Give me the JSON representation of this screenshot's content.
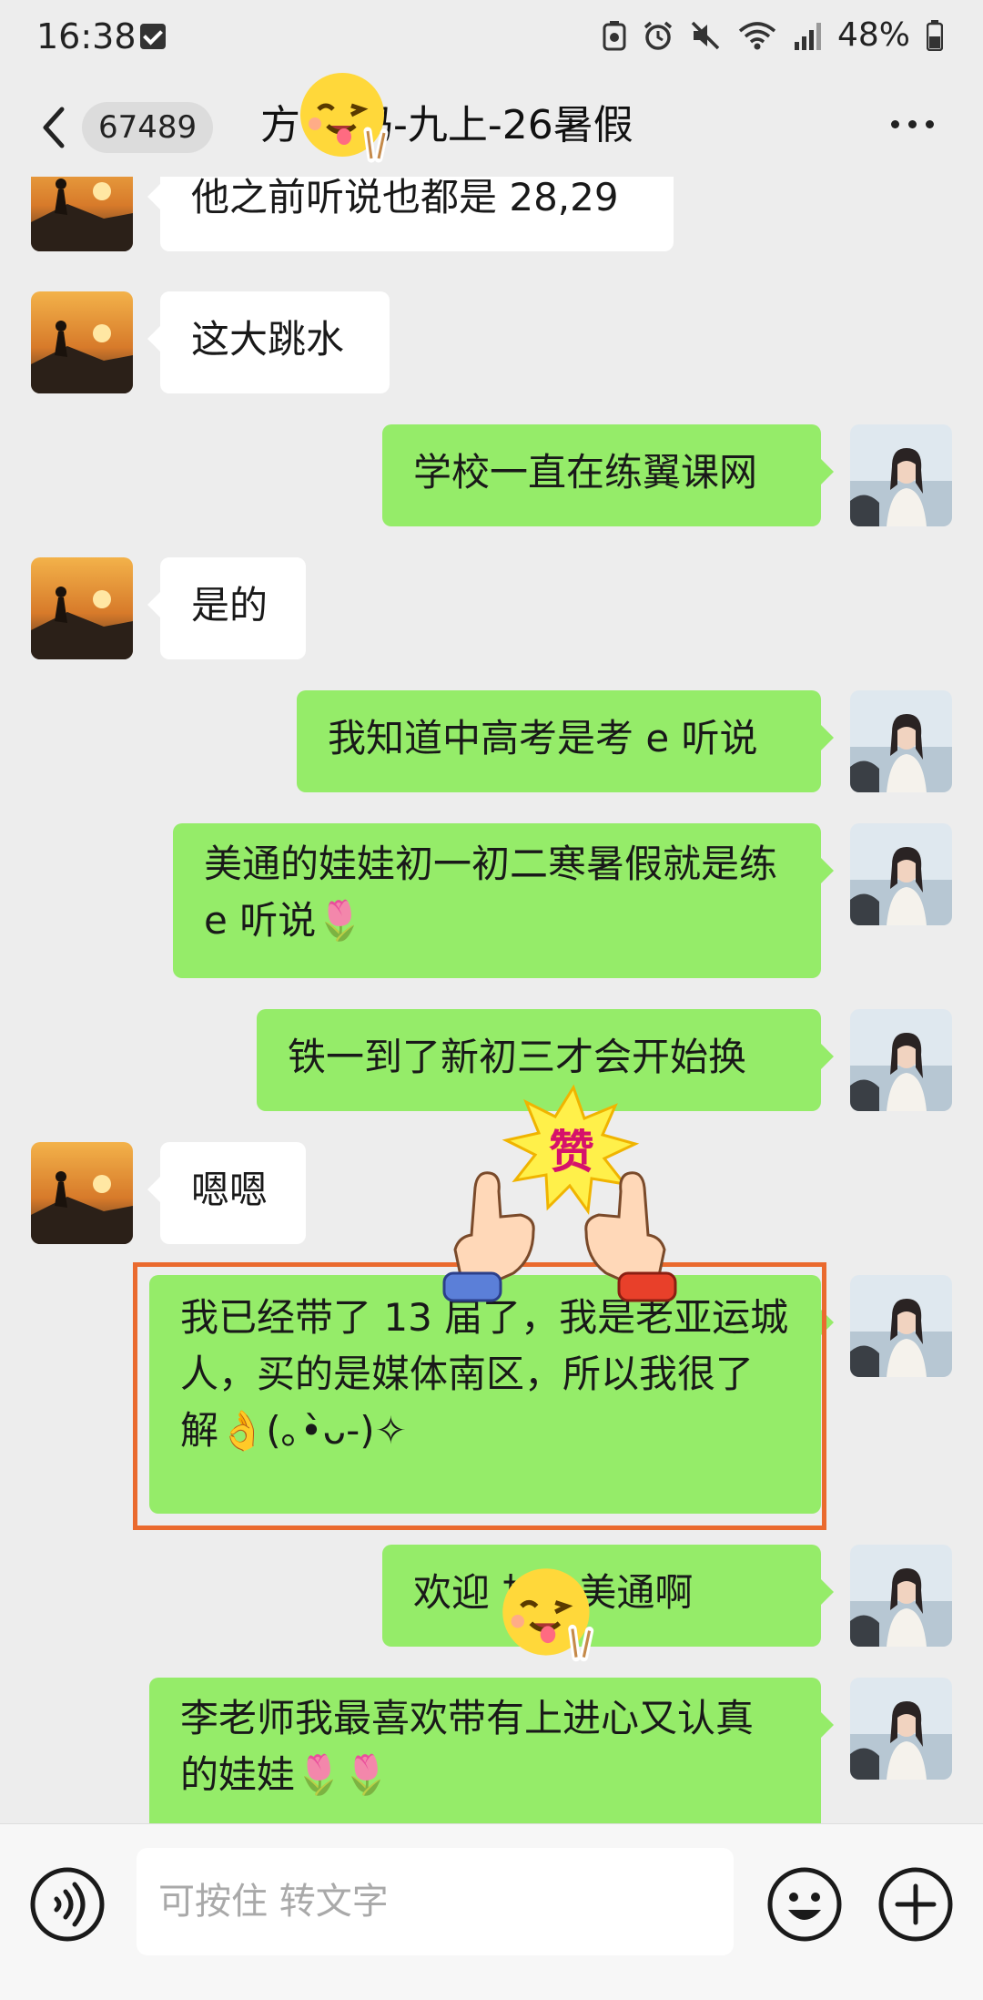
{
  "status_bar": {
    "time": "16:38",
    "battery": "48%"
  },
  "header": {
    "unread_count": "67489",
    "title": "方      妈妈-九上-26暑假"
  },
  "messages": [
    {
      "side": "left",
      "text": "他之前听说也都是 28,29"
    },
    {
      "side": "left",
      "text": "这大跳水"
    },
    {
      "side": "right",
      "text": "学校一直在练翼课网"
    },
    {
      "side": "left",
      "text": "是的"
    },
    {
      "side": "right",
      "text": "我知道中高考是考 e 听说"
    },
    {
      "side": "right",
      "text": "美通的娃娃初一初二寒暑假就是练 e 听说🌷"
    },
    {
      "side": "right",
      "text": "铁一到了新初三才会开始换"
    },
    {
      "side": "left",
      "text": "嗯嗯"
    },
    {
      "side": "right",
      "text": "我已经带了 13 届了，我是老亚运城人，买的是媒体南区，所以我很了解👌(｡•̀ᴗ-)✧"
    },
    {
      "side": "right",
      "text": "欢迎      加入美通啊"
    },
    {
      "side": "right",
      "text": "李老师我最喜欢带有上进心又认真的娃娃🌷🌷"
    }
  ],
  "sticker": {
    "label": "赞"
  },
  "input_bar": {
    "placeholder": "可按住 转文字"
  },
  "colors": {
    "background": "#ededed",
    "bubble_sent": "#95ec69",
    "bubble_received": "#ffffff",
    "highlight_border": "#ea6a2e"
  }
}
